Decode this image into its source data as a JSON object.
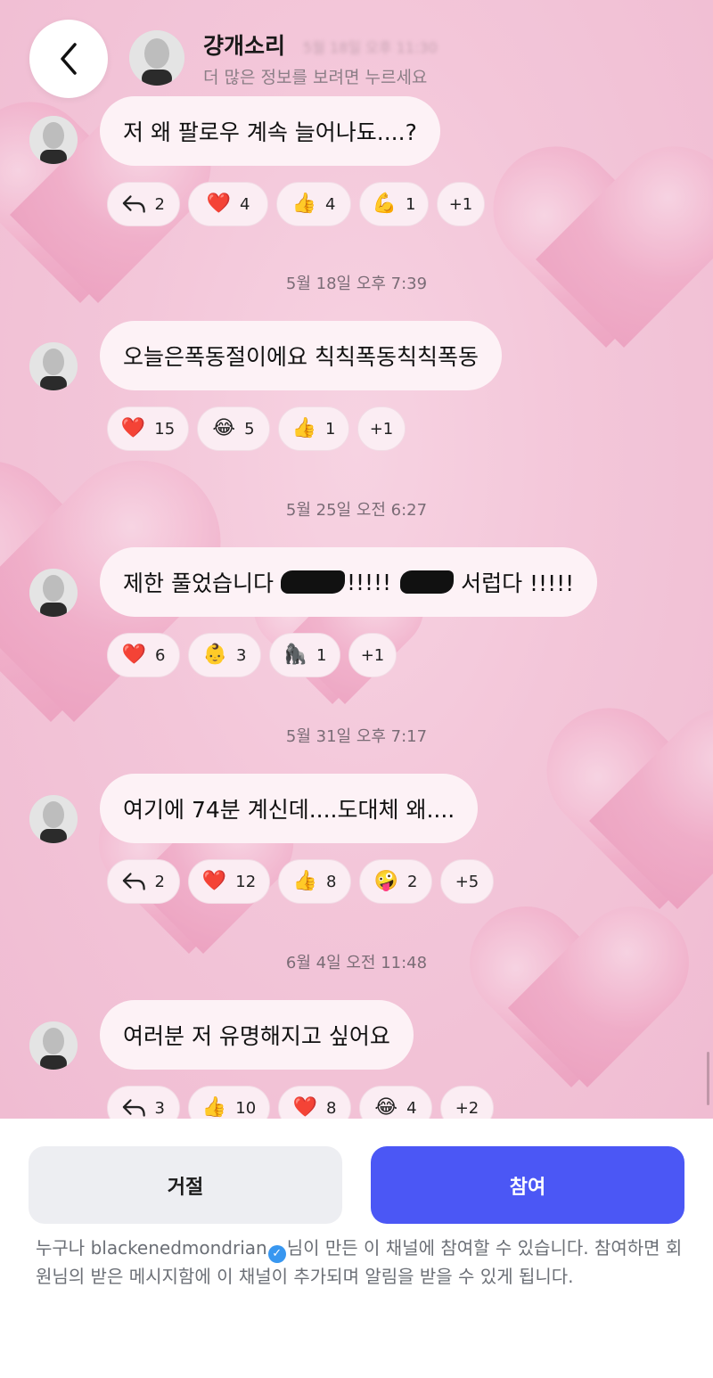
{
  "header": {
    "name": "걍개소리",
    "subtitle": "더 많은 정보를 보려면 누르세요",
    "faded_time": "5월 18일 오후 11:30"
  },
  "messages": [
    {
      "text": "저 왜 팔로우 계속 늘어나됴....?",
      "reactions": [
        {
          "icon": "reply-icon",
          "emoji": "",
          "count": "2"
        },
        {
          "icon": "heart-emoji-icon",
          "emoji": "❤️",
          "count": "4"
        },
        {
          "icon": "thumbs-up-emoji-icon",
          "emoji": "👍",
          "count": "4"
        },
        {
          "icon": "flexed-biceps-emoji-icon",
          "emoji": "💪",
          "count": "1"
        },
        {
          "icon": "",
          "emoji": "",
          "count": "+1"
        }
      ]
    },
    {
      "timestamp": "5월 18일 오후 7:39",
      "text": "오늘은폭동절이에요 칙칙폭동칙칙폭동",
      "reactions": [
        {
          "icon": "heart-emoji-icon",
          "emoji": "❤️",
          "count": "15"
        },
        {
          "icon": "tears-of-joy-emoji-icon",
          "emoji": "😂",
          "count": "5"
        },
        {
          "icon": "thumbs-up-emoji-icon",
          "emoji": "👍",
          "count": "1"
        },
        {
          "icon": "",
          "emoji": "",
          "count": "+1"
        }
      ]
    },
    {
      "timestamp": "5월 25일 오전 6:27",
      "text_before": "제한 풀었습니다",
      "text_middle": "!!!!!",
      "text_after": "서럽다 !!!!!",
      "reactions": [
        {
          "icon": "baby-face-emoji-icon",
          "emoji": "👶",
          "count": "3"
        },
        {
          "icon": "heart-emoji-icon",
          "emoji": "❤️",
          "count": "6"
        },
        {
          "icon": "gorilla-emoji-icon",
          "emoji": "🦍",
          "count": "1"
        },
        {
          "icon": "",
          "emoji": "",
          "count": "+1"
        }
      ]
    },
    {
      "timestamp": "5월 31일 오후 7:17",
      "text": "여기에 74분 계신데....도대체 왜....",
      "reactions": [
        {
          "icon": "reply-icon",
          "emoji": "",
          "count": "2"
        },
        {
          "icon": "heart-emoji-icon",
          "emoji": "❤️",
          "count": "12"
        },
        {
          "icon": "thumbs-up-emoji-icon",
          "emoji": "👍",
          "count": "8"
        },
        {
          "icon": "zany-face-emoji-icon",
          "emoji": "🤪",
          "count": "2"
        },
        {
          "icon": "",
          "emoji": "",
          "count": "+5"
        }
      ]
    },
    {
      "timestamp": "6월 4일 오전 11:48",
      "text": "여러분 저 유명해지고 싶어요",
      "reactions": [
        {
          "icon": "reply-icon",
          "emoji": "",
          "count": "3"
        },
        {
          "icon": "thumbs-up-emoji-icon",
          "emoji": "👍",
          "count": "10"
        },
        {
          "icon": "heart-emoji-icon",
          "emoji": "❤️",
          "count": "8"
        },
        {
          "icon": "tears-of-joy-emoji-icon",
          "emoji": "😂",
          "count": "4"
        },
        {
          "icon": "",
          "emoji": "",
          "count": "+2"
        }
      ]
    }
  ],
  "actions": {
    "decline_label": "거절",
    "join_label": "참여"
  },
  "notice": {
    "prefix": "누구나 ",
    "username": "blackenedmondrian",
    "suffix": "님이 만든 이 채널에 참여할 수 있습니다. 참여하면 회원님의 받은 메시지함에 이 채널이 추가되며 알림을 받을 수 있게 됩니다."
  },
  "colors": {
    "join_button": "#4b57f5",
    "decline_button": "#edeef2",
    "verified_badge": "#3897f0"
  }
}
